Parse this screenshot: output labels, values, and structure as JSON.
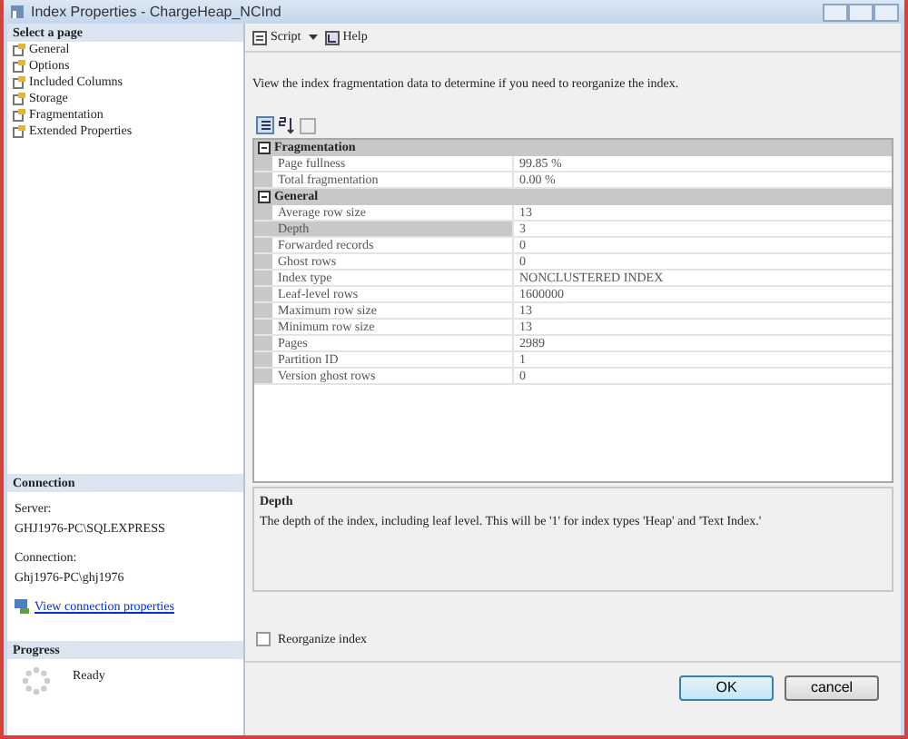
{
  "window": {
    "title": "Index Properties - ChargeHeap_NCInd"
  },
  "pages_header": "Select a page",
  "pages": [
    {
      "label": "General"
    },
    {
      "label": "Options"
    },
    {
      "label": "Included Columns"
    },
    {
      "label": "Storage"
    },
    {
      "label": "Fragmentation"
    },
    {
      "label": "Extended Properties"
    }
  ],
  "connection": {
    "header": "Connection",
    "server_label": "Server:",
    "server": "GHJ1976-PC\\SQLEXPRESS",
    "connection_label": "Connection:",
    "connection": "Ghj1976-PC\\ghj1976",
    "link": "View connection properties"
  },
  "progress": {
    "header": "Progress",
    "status": "Ready"
  },
  "toolbar": [
    "Script",
    "Help"
  ],
  "intro": "View the index fragmentation data to determine if you need to reorganize the index.",
  "grid": [
    {
      "category": "Fragmentation",
      "expanded": true,
      "rows": [
        {
          "name": "Page fullness",
          "value": "99.85 %",
          "selected": false
        },
        {
          "name": "Total fragmentation",
          "value": "0.00 %",
          "selected": false
        }
      ]
    },
    {
      "category": "General",
      "expanded": true,
      "rows": [
        {
          "name": "Average row size",
          "value": "13",
          "selected": false
        },
        {
          "name": "Depth",
          "value": "3",
          "selected": true
        },
        {
          "name": "Forwarded records",
          "value": "0",
          "selected": false
        },
        {
          "name": "Ghost rows",
          "value": "0",
          "selected": false
        },
        {
          "name": "Index type",
          "value": "NONCLUSTERED INDEX",
          "selected": false
        },
        {
          "name": "Leaf-level rows",
          "value": "1600000",
          "selected": false
        },
        {
          "name": "Maximum row size",
          "value": "13",
          "selected": false
        },
        {
          "name": "Minimum row size",
          "value": "13",
          "selected": false
        },
        {
          "name": "Pages",
          "value": "2989",
          "selected": false
        },
        {
          "name": "Partition ID",
          "value": "1",
          "selected": false
        },
        {
          "name": "Version ghost rows",
          "value": "0",
          "selected": false
        }
      ]
    }
  ],
  "description": {
    "title": "Depth",
    "text": "The depth of the index, including leaf level.  This will be '1' for index types 'Heap' and 'Text Index.'"
  },
  "reorganize": {
    "label": "Reorganize index",
    "checked": false
  },
  "buttons": [
    {
      "label": "OK",
      "kind": "default"
    },
    {
      "label": "cancel",
      "kind": "normal"
    }
  ]
}
